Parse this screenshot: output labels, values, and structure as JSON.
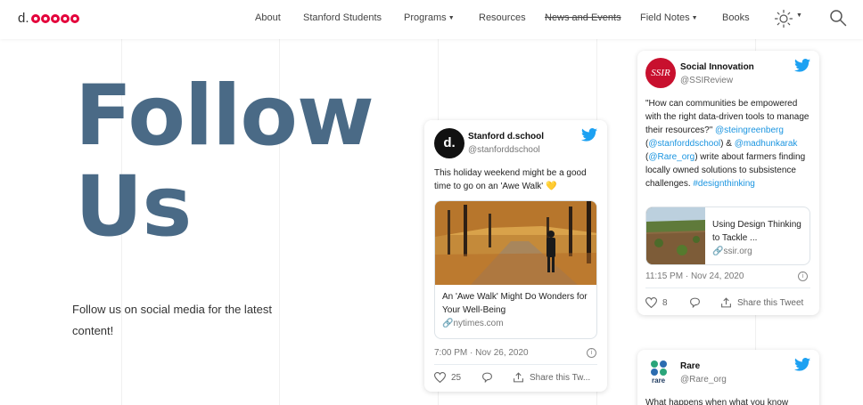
{
  "header": {
    "logo_text": "d.",
    "nav": [
      {
        "label": "About"
      },
      {
        "label": "Stanford Students"
      },
      {
        "label": "Programs",
        "caret": "▼"
      },
      {
        "label": "Resources"
      },
      {
        "label": "News and Events"
      },
      {
        "label": "Field Notes",
        "caret": "▼"
      },
      {
        "label": "Books"
      }
    ],
    "theme_icon": "sun-icon",
    "search_icon": "search-icon"
  },
  "hero": {
    "title_line1": "Follow",
    "title_line2": "Us",
    "subtitle": "Follow us on social media for the latest content!"
  },
  "tweets": {
    "dschool": {
      "name": "Stanford d.school",
      "handle": "@stanforddschool",
      "avatar_letter": "d.",
      "text": "This holiday weekend might be a good time to go on an 'Awe Walk' 💛",
      "link_title": "An 'Awe Walk' Might Do Wonders for Your Well-Being",
      "link_domain": "nytimes.com",
      "time": "7:00 PM · Nov 26, 2020",
      "likes": "25",
      "share": "Share this Tw..."
    },
    "ssir": {
      "name": "Social Innovation",
      "handle": "@SSIReview",
      "avatar_text": "SSIR",
      "text_1": "\"How can communities be empowered with the right data-driven tools to manage their resources?\"",
      "mention_1": "@steingreenberg",
      "paren_open": " (",
      "mention_2": "@stanforddschool",
      "paren_close": ")",
      "amp": "& ",
      "mention_3": "@madhunkarak",
      "paren_open_2": " (",
      "mention_4": "@Rare_org",
      "text_2": ") write about farmers finding locally owned solutions to subsistence challenges.",
      "hashtag": "#designthinking",
      "link_title": "Using Design Thinking to Tackle ...",
      "link_domain": "ssir.org",
      "time": "11:15 PM · Nov 24, 2020",
      "likes": "8",
      "share": "Share this Tweet"
    },
    "rare": {
      "name": "Rare",
      "handle": "@Rare_org",
      "avatar_text": "rare",
      "text": "What happens when what you know"
    }
  },
  "colors": {
    "accent": "#4a6a86",
    "twitter": "#1da1f2",
    "logo_red": "#e4003b",
    "link": "#1b95e0"
  }
}
